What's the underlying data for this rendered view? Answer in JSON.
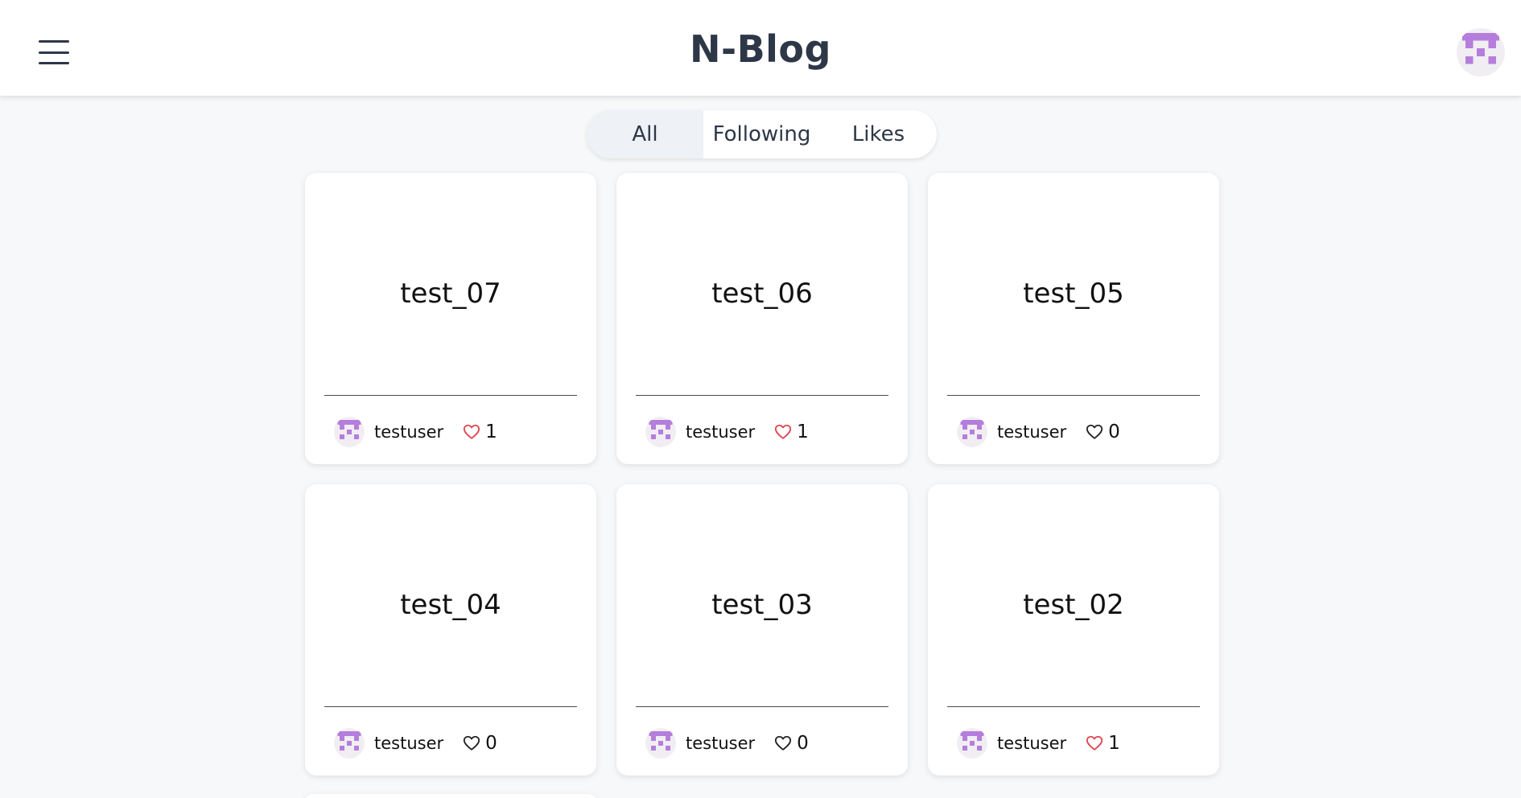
{
  "header": {
    "title": "N-Blog",
    "menu_icon": "hamburger-icon",
    "avatar_icon": "identicon-avatar"
  },
  "tabs": [
    {
      "label": "All",
      "active": true
    },
    {
      "label": "Following",
      "active": false
    },
    {
      "label": "Likes",
      "active": false
    }
  ],
  "posts": [
    {
      "title": "test_07",
      "author": "testuser",
      "likes": "1",
      "liked": true
    },
    {
      "title": "test_06",
      "author": "testuser",
      "likes": "1",
      "liked": true
    },
    {
      "title": "test_05",
      "author": "testuser",
      "likes": "0",
      "liked": false
    },
    {
      "title": "test_04",
      "author": "testuser",
      "likes": "0",
      "liked": false
    },
    {
      "title": "test_03",
      "author": "testuser",
      "likes": "0",
      "liked": false
    },
    {
      "title": "test_02",
      "author": "testuser",
      "likes": "1",
      "liked": true
    }
  ],
  "colors": {
    "accent_liked": "#e0454f",
    "unliked": "#222222",
    "avatar_purple": "#b57edc"
  }
}
